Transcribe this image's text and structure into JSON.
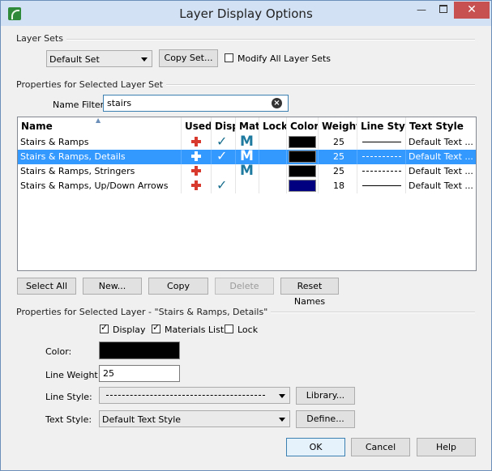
{
  "window": {
    "title": "Layer Display Options"
  },
  "layer_sets": {
    "group_label": "Layer Sets",
    "selected_set": "Default Set",
    "copy_set_label": "Copy Set...",
    "modify_all_label": "Modify All Layer Sets",
    "modify_all_checked": false
  },
  "properties_set": {
    "group_label": "Properties for Selected Layer Set",
    "name_filter_label": "Name Filter:",
    "name_filter_value": "stairs"
  },
  "table": {
    "columns": [
      "Name",
      "Used",
      "Disp",
      "Mat",
      "Lock",
      "Color",
      "Weight",
      "Line Style",
      "Text Style"
    ],
    "rows": [
      {
        "name": "Stairs & Ramps",
        "used": true,
        "disp": true,
        "mat": "M",
        "lock": false,
        "color": "#000000",
        "weight": "25",
        "line_style": "solid",
        "text_style": "Default Text ...",
        "selected": false
      },
      {
        "name": "Stairs & Ramps, Details",
        "used": true,
        "disp": true,
        "mat": "M",
        "lock": false,
        "color": "#000000",
        "weight": "25",
        "line_style": "dashed",
        "text_style": "Default Text ...",
        "selected": true
      },
      {
        "name": "Stairs & Ramps, Stringers",
        "used": true,
        "disp": false,
        "mat": "M",
        "lock": false,
        "color": "#000000",
        "weight": "25",
        "line_style": "dashed",
        "text_style": "Default Text ...",
        "selected": false
      },
      {
        "name": "Stairs & Ramps, Up/Down Arrows",
        "used": true,
        "disp": true,
        "mat": "",
        "lock": false,
        "color": "#000080",
        "weight": "18",
        "line_style": "solid",
        "text_style": "Default Text ...",
        "selected": false
      }
    ]
  },
  "table_buttons": {
    "select_all": "Select All",
    "new": "New...",
    "copy": "Copy",
    "delete": "Delete",
    "reset_names": "Reset Names"
  },
  "properties_layer": {
    "group_label": "Properties for Selected Layer - \"Stairs & Ramps, Details\"",
    "display_label": "Display",
    "display_checked": true,
    "materials_label": "Materials List",
    "materials_checked": true,
    "lock_label": "Lock",
    "lock_checked": false,
    "color_label": "Color:",
    "color_value": "#000000",
    "line_weight_label": "Line Weight:",
    "line_weight_value": "25",
    "line_style_label": "Line Style:",
    "library_label": "Library...",
    "text_style_label": "Text Style:",
    "text_style_value": "Default Text Style",
    "define_label": "Define..."
  },
  "footer": {
    "ok": "OK",
    "cancel": "Cancel",
    "help": "Help"
  },
  "icons": {
    "app": "chief-architect-icon",
    "clear": "clear-icon",
    "used": "plus-icon",
    "disp": "checkmark-icon",
    "mat": "materials-m-icon"
  }
}
